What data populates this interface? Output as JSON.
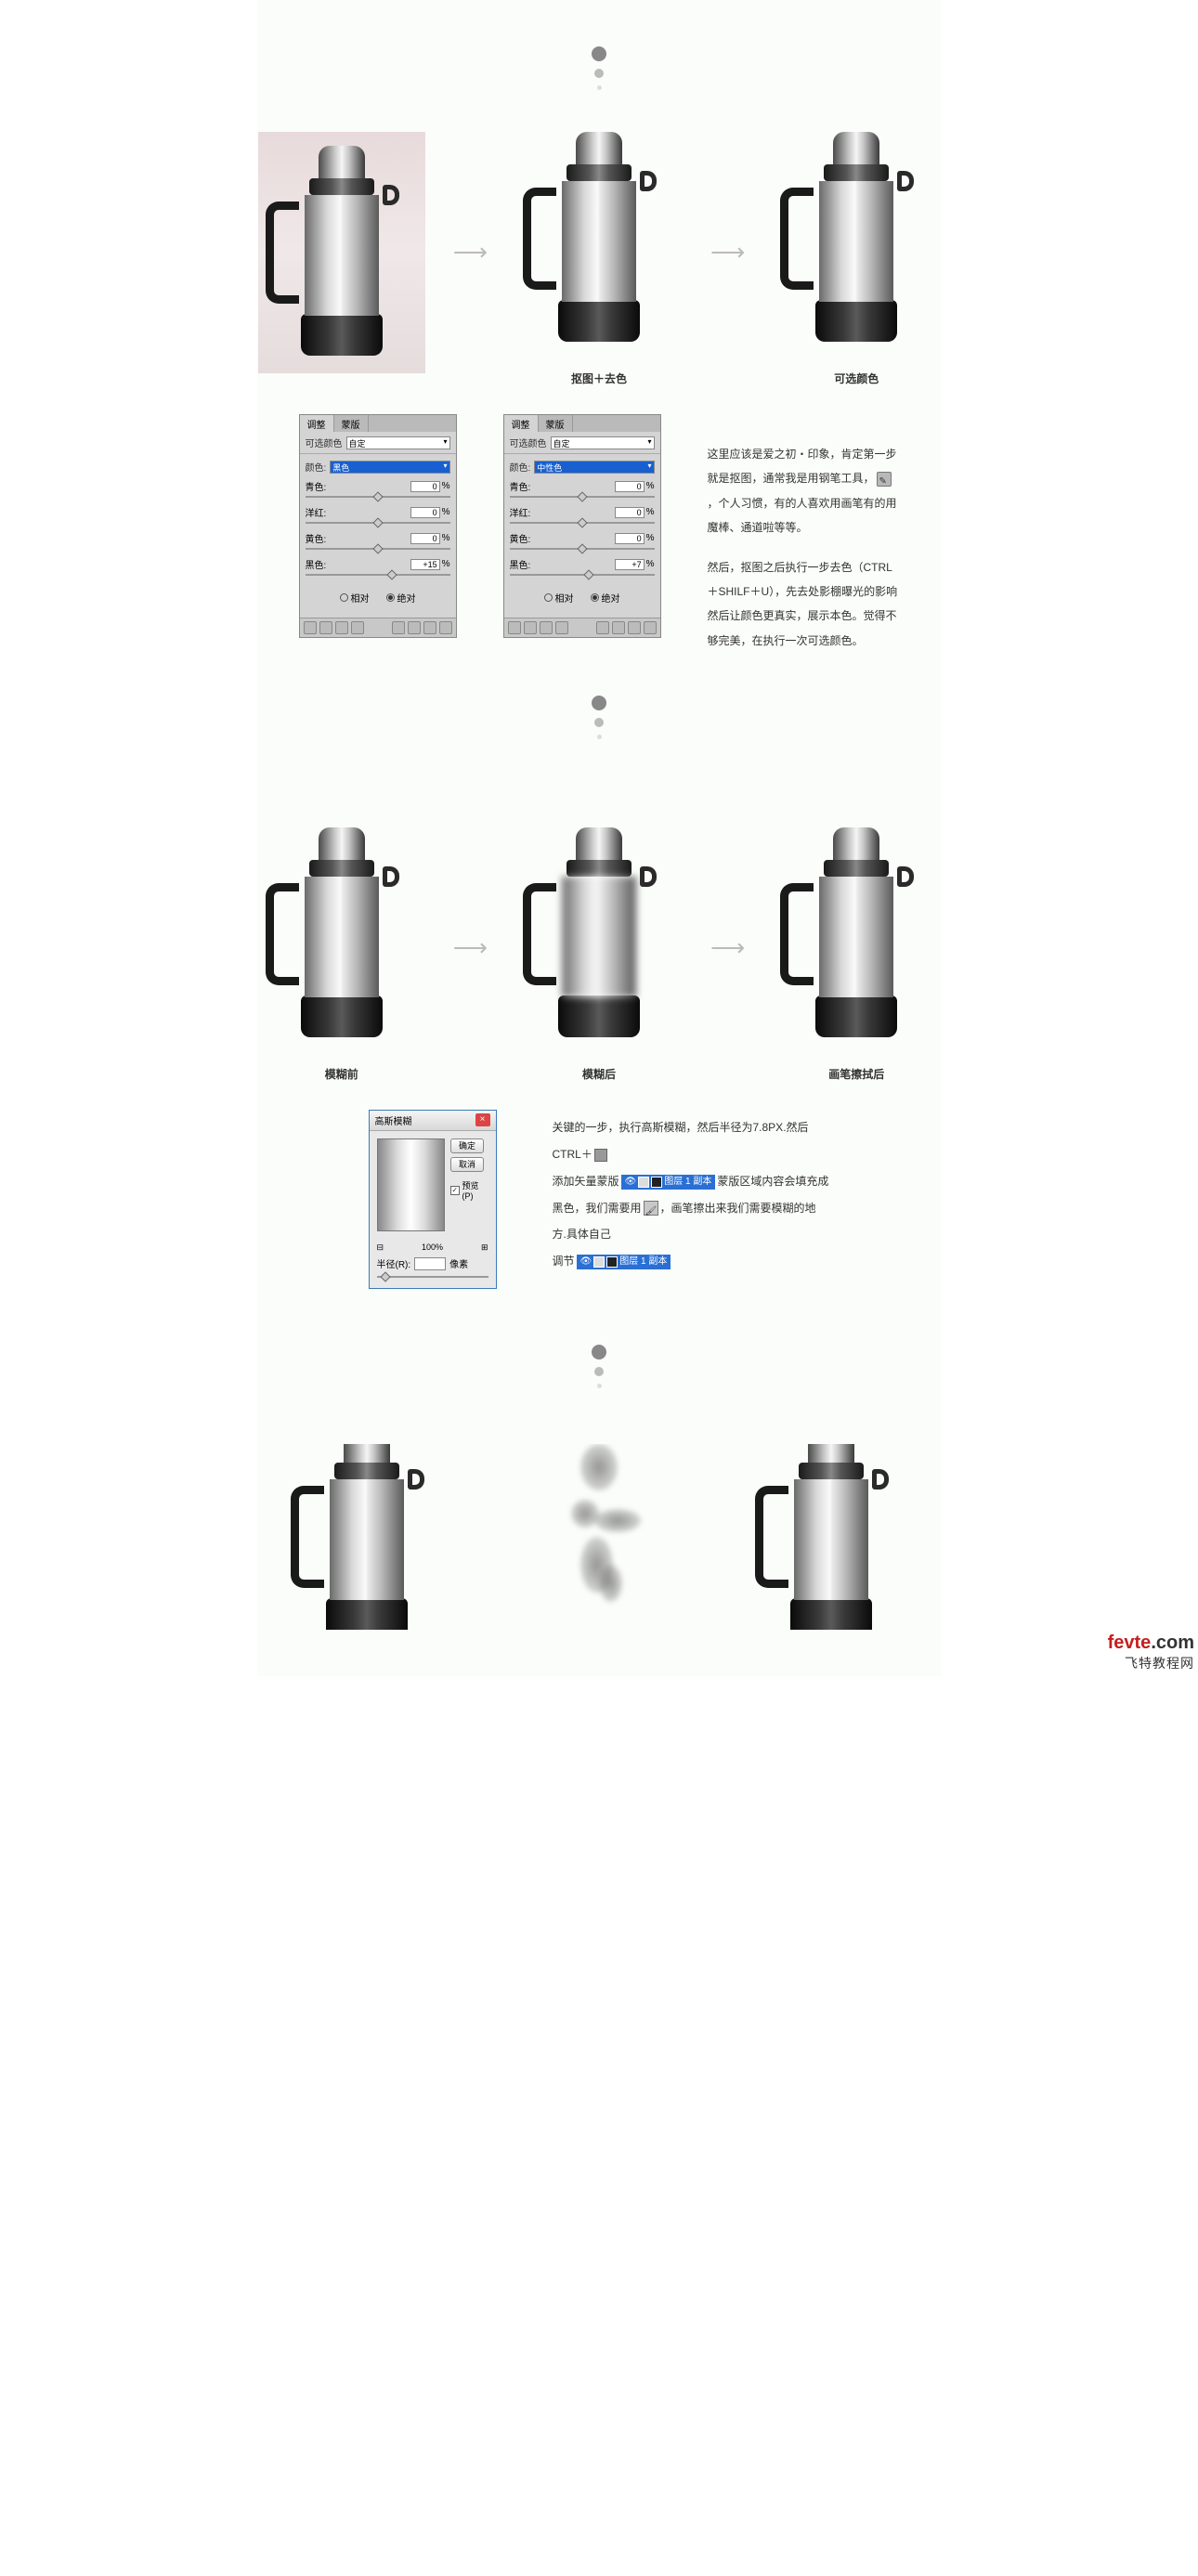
{
  "section1": {
    "caption_mid": "抠图＋去色",
    "caption_right": "可选颜色"
  },
  "panels": {
    "tab1": "调整",
    "tab2": "蒙版",
    "title_label": "可选颜色",
    "mode": "自定",
    "color_label": "颜色:",
    "color_value_1": "黑色",
    "color_value_2": "中性色",
    "rows": {
      "cyan": "青色:",
      "magenta": "洋红:",
      "yellow": "黄色:",
      "black": "黑色:"
    },
    "vals1": {
      "cyan": "0",
      "magenta": "0",
      "yellow": "0",
      "black": "+15"
    },
    "vals2": {
      "cyan": "0",
      "magenta": "0",
      "yellow": "0",
      "black": "+7"
    },
    "percent": "%",
    "radio_rel": "相对",
    "radio_abs": "绝对"
  },
  "text1": {
    "p1a": "这里应该是爱之初・印象，肯定第一步就是抠图，通常我是用钢笔工具，",
    "p1b": "，个人习惯，有的人喜欢用画笔有的用魔棒、通道啦等等。",
    "p2": "然后，抠图之后执行一步去色（CTRL＋SHILF＋U），先去处影棚曝光的影响然后让颜色更真实，展示本色。觉得不够完美，在执行一次可选颜色。"
  },
  "section2": {
    "caption_left": "模糊前",
    "caption_mid": "模糊后",
    "caption_right": "画笔擦拭后"
  },
  "dialog": {
    "title": "高斯模糊",
    "ok": "确定",
    "cancel": "取消",
    "preview_cb": "预览(P)",
    "zoom_minus": "⊟",
    "zoom_val": "100%",
    "zoom_plus": "⊞",
    "radius_label": "半径(R):",
    "radius_val": "",
    "radius_unit": "像素"
  },
  "text2": {
    "l1a": "关键的一步，执行高斯模糊，然后半径为7.8PX.然后CTRL＋",
    "l2a": "添加矢量蒙版",
    "layer_name": "图层 1 副本",
    "l2b": "蒙版区域内容会填充成",
    "l3a": "黑色，我们需要用",
    "l3b": "，画笔擦出来我们需要模糊的地方.具体自己",
    "l4a": "调节"
  },
  "watermark": {
    "brand": "fevte",
    "dot": ".com",
    "sub": "飞特教程网"
  }
}
